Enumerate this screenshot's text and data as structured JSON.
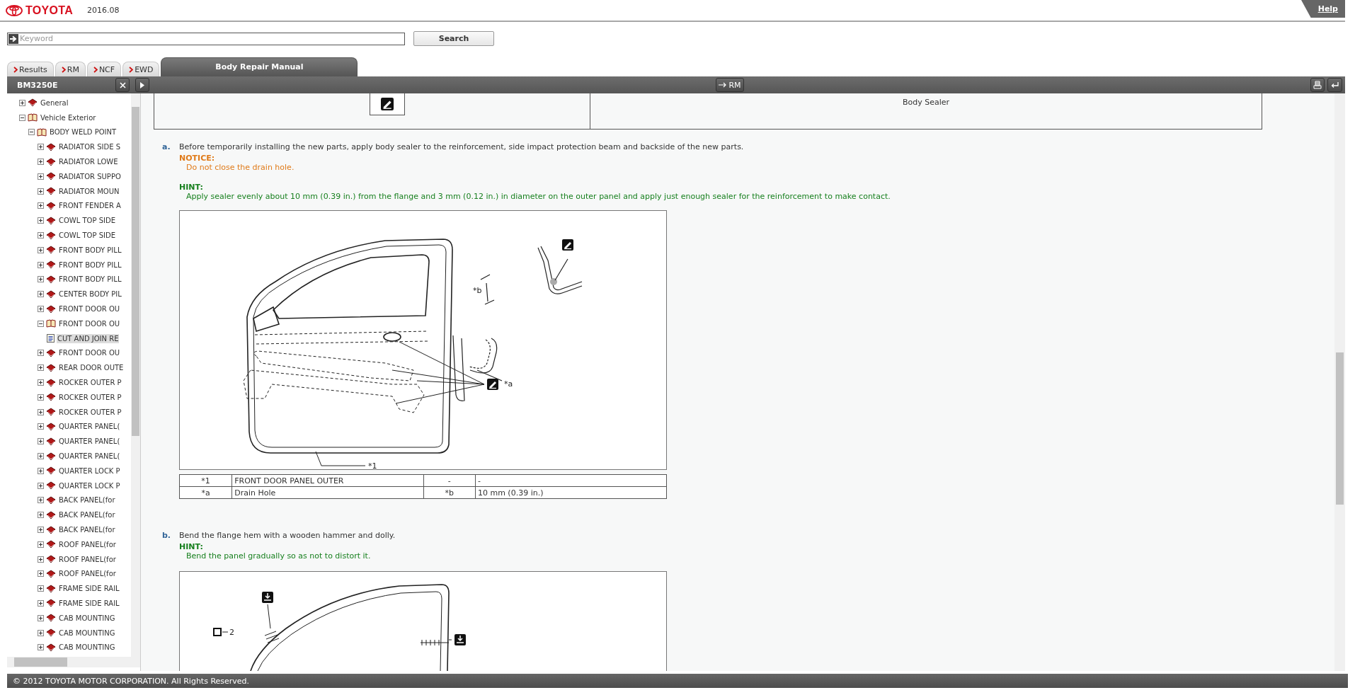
{
  "header": {
    "logo": "TOYOTA",
    "version": "2016.08",
    "help": "Help"
  },
  "search": {
    "placeholder": "Keyword",
    "button": "Search"
  },
  "tabs": [
    {
      "label": "Results",
      "selected": false
    },
    {
      "label": "RM",
      "selected": false
    },
    {
      "label": "NCF",
      "selected": false
    },
    {
      "label": "EWD",
      "selected": false
    },
    {
      "label": "Body Repair Manual",
      "selected": true
    }
  ],
  "toolbar": {
    "document_id": "BM3250E",
    "rm_button": "RM"
  },
  "tree": [
    {
      "label": "General",
      "kind": "book",
      "expanded": false,
      "selected": false
    },
    {
      "label": "Vehicle Exterior",
      "kind": "book",
      "expanded": true,
      "selected": false,
      "children": [
        {
          "label": "BODY WELD POINT",
          "kind": "book",
          "expanded": true,
          "selected": false,
          "children": [
            {
              "label": "RADIATOR SIDE S",
              "kind": "book",
              "expanded": false,
              "selected": false
            },
            {
              "label": "RADIATOR LOWE",
              "kind": "book",
              "expanded": false,
              "selected": false
            },
            {
              "label": "RADIATOR SUPPO",
              "kind": "book",
              "expanded": false,
              "selected": false
            },
            {
              "label": "RADIATOR MOUN",
              "kind": "book",
              "expanded": false,
              "selected": false
            },
            {
              "label": "FRONT FENDER A",
              "kind": "book",
              "expanded": false,
              "selected": false
            },
            {
              "label": "COWL TOP SIDE",
              "kind": "book",
              "expanded": false,
              "selected": false
            },
            {
              "label": "COWL TOP SIDE",
              "kind": "book",
              "expanded": false,
              "selected": false
            },
            {
              "label": "FRONT BODY PILL",
              "kind": "book",
              "expanded": false,
              "selected": false
            },
            {
              "label": "FRONT BODY PILL",
              "kind": "book",
              "expanded": false,
              "selected": false
            },
            {
              "label": "FRONT BODY PILL",
              "kind": "book",
              "expanded": false,
              "selected": false
            },
            {
              "label": "CENTER BODY PIL",
              "kind": "book",
              "expanded": false,
              "selected": false
            },
            {
              "label": "FRONT DOOR OU",
              "kind": "book",
              "expanded": false,
              "selected": false
            },
            {
              "label": "FRONT DOOR OU",
              "kind": "book",
              "expanded": true,
              "selected": false,
              "children": [
                {
                  "label": "CUT AND JOIN RE",
                  "kind": "document",
                  "selected": true
                }
              ]
            },
            {
              "label": "FRONT DOOR OU",
              "kind": "book",
              "expanded": false,
              "selected": false
            },
            {
              "label": "REAR DOOR OUTE",
              "kind": "book",
              "expanded": false,
              "selected": false
            },
            {
              "label": "ROCKER OUTER P",
              "kind": "book",
              "expanded": false,
              "selected": false
            },
            {
              "label": "ROCKER OUTER P",
              "kind": "book",
              "expanded": false,
              "selected": false
            },
            {
              "label": "ROCKER OUTER P",
              "kind": "book",
              "expanded": false,
              "selected": false
            },
            {
              "label": "QUARTER PANEL(",
              "kind": "book",
              "expanded": false,
              "selected": false
            },
            {
              "label": "QUARTER PANEL(",
              "kind": "book",
              "expanded": false,
              "selected": false
            },
            {
              "label": "QUARTER PANEL(",
              "kind": "book",
              "expanded": false,
              "selected": false
            },
            {
              "label": "QUARTER LOCK P",
              "kind": "book",
              "expanded": false,
              "selected": false
            },
            {
              "label": "QUARTER LOCK P",
              "kind": "book",
              "expanded": false,
              "selected": false
            },
            {
              "label": "BACK PANEL(for",
              "kind": "book",
              "expanded": false,
              "selected": false
            },
            {
              "label": "BACK PANEL(for",
              "kind": "book",
              "expanded": false,
              "selected": false
            },
            {
              "label": "BACK PANEL(for",
              "kind": "book",
              "expanded": false,
              "selected": false
            },
            {
              "label": "ROOF PANEL(for",
              "kind": "book",
              "expanded": false,
              "selected": false
            },
            {
              "label": "ROOF PANEL(for",
              "kind": "book",
              "expanded": false,
              "selected": false
            },
            {
              "label": "ROOF PANEL(for",
              "kind": "book",
              "expanded": false,
              "selected": false
            },
            {
              "label": "FRAME SIDE RAIL",
              "kind": "book",
              "expanded": false,
              "selected": false
            },
            {
              "label": "FRAME SIDE RAIL",
              "kind": "book",
              "expanded": false,
              "selected": false
            },
            {
              "label": "CAB MOUNTING",
              "kind": "book",
              "expanded": false,
              "selected": false
            },
            {
              "label": "CAB MOUNTING",
              "kind": "book",
              "expanded": false,
              "selected": false
            },
            {
              "label": "CAB MOUNTING",
              "kind": "book",
              "expanded": false,
              "selected": false
            }
          ]
        }
      ]
    }
  ],
  "content": {
    "top_table": {
      "column_2": "Body Sealer"
    },
    "steps": [
      {
        "marker": "a.",
        "text": "Before temporarily installing the new parts, apply body sealer to the reinforcement, side impact protection beam and backside of the new parts.",
        "notes": [
          {
            "kind": "notice",
            "title": "NOTICE:",
            "text": "Do not close the drain hole."
          },
          {
            "kind": "hint",
            "title": "HINT:",
            "text": "Apply sealer evenly about 10 mm (0.39 in.) from the flange and 3 mm (0.12 in.) in diameter on the outer panel and apply just enough sealer for the reinforcement to make contact."
          }
        ],
        "figure": {
          "kind": "sealer",
          "callouts": [
            "*1",
            "*b",
            "*a"
          ]
        },
        "legend": [
          [
            "*1",
            "FRONT DOOR PANEL OUTER",
            "-",
            "-"
          ],
          [
            "*a",
            "Drain Hole",
            "*b",
            "10 mm (0.39 in.)"
          ]
        ]
      },
      {
        "marker": "b.",
        "text": "Bend the flange hem with a wooden hammer and dolly.",
        "notes": [
          {
            "kind": "hint",
            "title": "HINT:",
            "text": "Bend the panel gradually so as not to distort it."
          }
        ],
        "figure": {
          "kind": "hem",
          "callouts": [
            "2"
          ]
        }
      }
    ]
  },
  "footer": "© 2012 TOYOTA MOTOR CORPORATION. All Rights Reserved."
}
